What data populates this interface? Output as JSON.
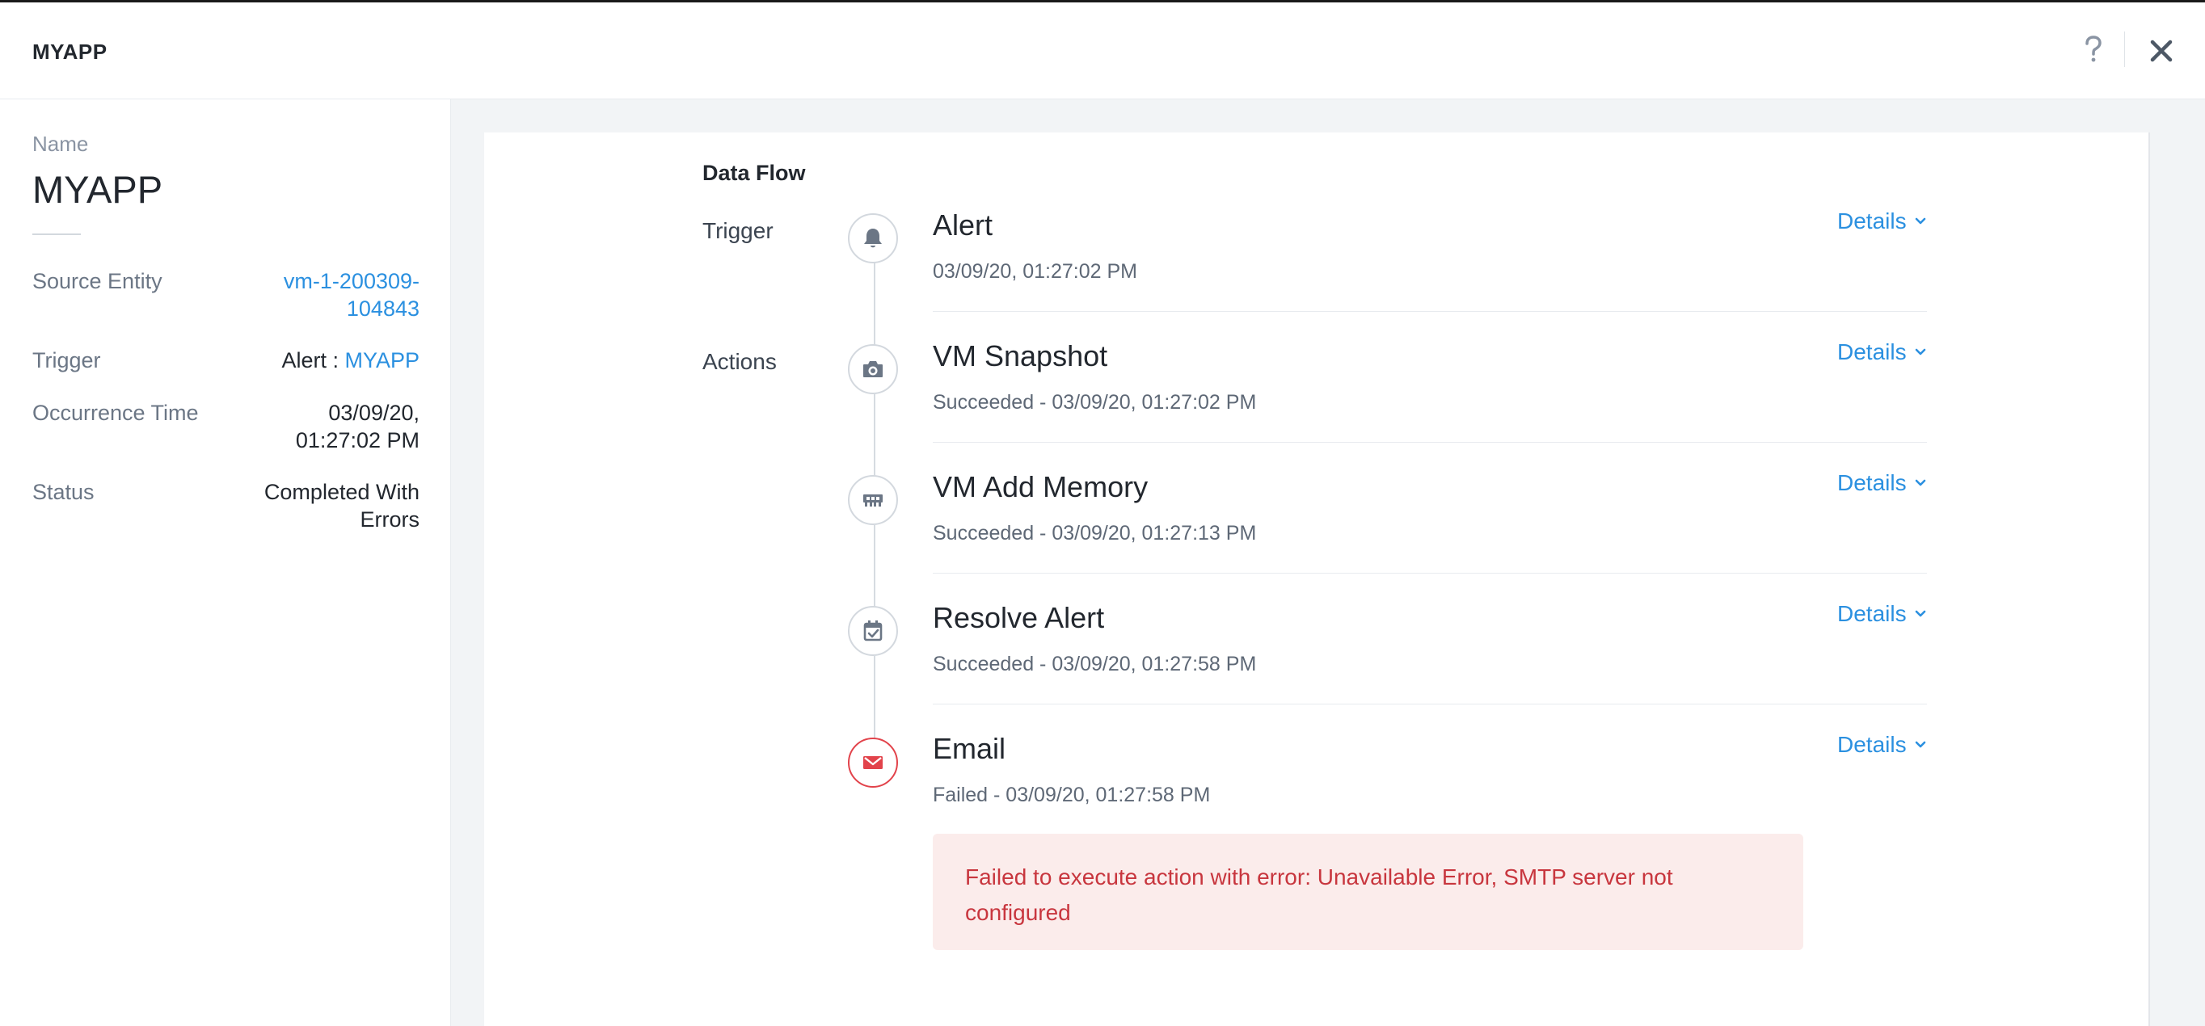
{
  "header": {
    "title": "MYAPP",
    "help_icon": "question-mark-icon",
    "close_icon": "close-icon"
  },
  "sidebar": {
    "name_label": "Name",
    "name_value": "MYAPP",
    "properties": {
      "source_entity": {
        "label": "Source Entity",
        "value_line1": "vm-1-200309-",
        "value_line2": "104843"
      },
      "trigger": {
        "label": "Trigger",
        "prefix": "Alert : ",
        "link": "MYAPP"
      },
      "occurrence_time": {
        "label": "Occurrence Time",
        "value_line1": "03/09/20,",
        "value_line2": "01:27:02 PM"
      },
      "status": {
        "label": "Status",
        "value_line1": "Completed With",
        "value_line2": "Errors"
      }
    }
  },
  "data_flow": {
    "title": "Data Flow",
    "trigger_label": "Trigger",
    "actions_label": "Actions",
    "details_label": "Details",
    "items": [
      {
        "title": "Alert",
        "subtitle": "03/09/20, 01:27:02 PM",
        "icon": "bell-icon",
        "status": "neutral"
      },
      {
        "title": "VM Snapshot",
        "subtitle": "Succeeded - 03/09/20, 01:27:02 PM",
        "icon": "camera-icon",
        "status": "succeeded"
      },
      {
        "title": "VM Add Memory",
        "subtitle": "Succeeded - 03/09/20, 01:27:13 PM",
        "icon": "memory-icon",
        "status": "succeeded"
      },
      {
        "title": "Resolve Alert",
        "subtitle": "Succeeded - 03/09/20, 01:27:58 PM",
        "icon": "calendar-check-icon",
        "status": "succeeded"
      },
      {
        "title": "Email",
        "subtitle": "Failed - 03/09/20, 01:27:58 PM",
        "icon": "envelope-icon",
        "status": "failed"
      }
    ],
    "error": {
      "line1": "Failed to execute action with error: Unavailable Error, SMTP server not",
      "line2": "configured"
    }
  },
  "colors": {
    "link": "#2b90e0",
    "error_text": "#c8363e",
    "error_bg": "#fbeceb",
    "failed_ring": "#e2434b",
    "icon_gray": "#6b7685"
  }
}
